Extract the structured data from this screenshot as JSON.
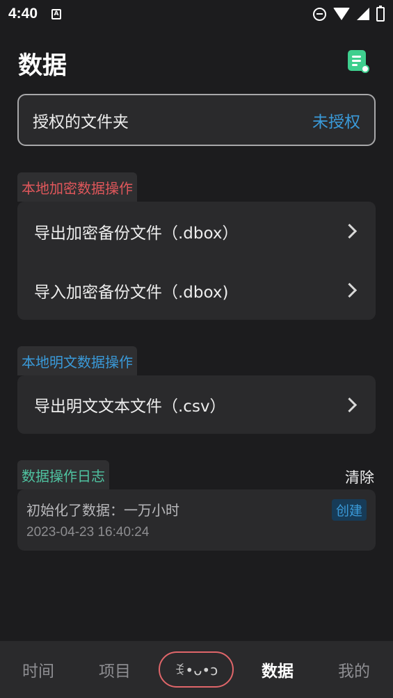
{
  "status_bar": {
    "time": "4:40",
    "a_icon_letter": "A"
  },
  "header": {
    "title": "数据"
  },
  "auth": {
    "label": "授权的文件夹",
    "status": "未授权"
  },
  "encrypted": {
    "tag": "本地加密数据操作",
    "items": [
      {
        "label": "导出加密备份文件（.dbox）"
      },
      {
        "label": "导入加密备份文件（.dbox)"
      }
    ]
  },
  "plaintext": {
    "tag": "本地明文数据操作",
    "items": [
      {
        "label": "导出明文文本文件（.csv）"
      }
    ]
  },
  "log": {
    "tag": "数据操作日志",
    "clear_label": "清除",
    "entries": [
      {
        "text": "初始化了数据：一万小时",
        "time": "2023-04-23 16:40:24",
        "badge": "创建"
      }
    ]
  },
  "nav": {
    "items": [
      "时间",
      "项目",
      "数据",
      "我的"
    ],
    "center_label": "ꉂ•ᴗ•ↄ",
    "active": "数据"
  },
  "colors": {
    "background": "#1c1c1e",
    "accent_blue": "#3a9ad9",
    "accent_red": "#e0575b",
    "accent_teal": "#4fc3a1",
    "note_green": "#3ecf8e"
  }
}
